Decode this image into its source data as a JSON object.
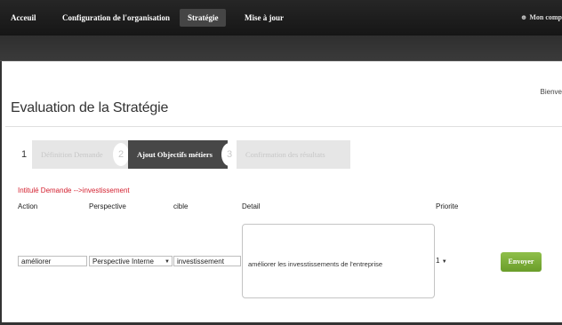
{
  "nav": {
    "items": [
      "Acceuil",
      "Configuration de l'organisation",
      "Stratégie",
      "Mise à jour"
    ],
    "active": "Stratégie",
    "user": "Mon comp"
  },
  "welcome": "Bienve",
  "page_title": "Evaluation de la Stratégie",
  "wizard": {
    "step1_num": "1",
    "step1_label": "Définition Demande",
    "step2_num": "2",
    "step2_label": "Ajout Objectifs métiers",
    "step3_num": "3",
    "step3_label": "Confirmation des résultats"
  },
  "request_label": "Intitulé Demande -->investissement",
  "columns": {
    "action": "Action",
    "perspective": "Perspective",
    "cible": "cible",
    "detail": "Detail",
    "priorite": "Priorite"
  },
  "row": {
    "action": "améliorer",
    "perspective": "Perspective Interne",
    "cible": "investissement",
    "detail": "améliorer les invesstissements de l'entreprise",
    "priorite": "1"
  },
  "send_label": "Envoyer",
  "colors": {
    "nav_bg": "#1e1e1e",
    "accent_green": "#7aad36",
    "request_red": "#d3202f"
  }
}
